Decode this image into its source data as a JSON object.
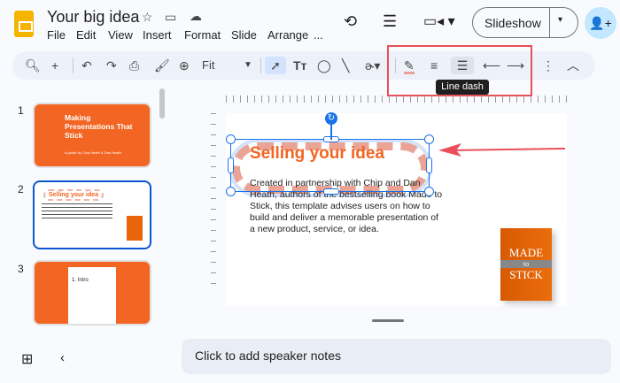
{
  "header": {
    "title": "Your big idea",
    "menu": [
      "File",
      "Edit",
      "View",
      "Insert",
      "Format",
      "Slide",
      "Arrange",
      "..."
    ],
    "slideshow_label": "Slideshow"
  },
  "toolbar": {
    "zoom_value": "Fit",
    "tooltip": "Line dash",
    "highlight_color": "#ea4e5a"
  },
  "slides": [
    {
      "number": "1",
      "title": "Making Presentations That Stick",
      "subtitle": "A guide by Chip Heath & Dan Heath"
    },
    {
      "number": "2",
      "title": "Selling your idea"
    },
    {
      "number": "3",
      "title": "1. Intro"
    }
  ],
  "current_slide": {
    "title": "Selling your idea",
    "body": "Created in partnership with Chip and Dan Heath, authors of the bestselling book Made to Stick, this template advises users on how to build and deliver a memorable presentation of a new product, service, or idea.",
    "book": {
      "line1": "MADE",
      "line2": "to",
      "line3": "STICK"
    }
  },
  "notes": {
    "placeholder": "Click to add speaker notes"
  },
  "colors": {
    "accent": "#f26522",
    "selection": "#1a73e8"
  }
}
